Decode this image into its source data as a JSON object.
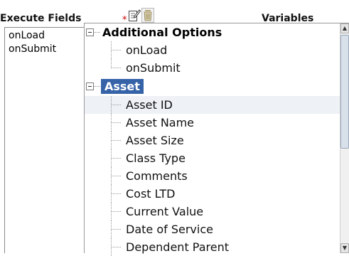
{
  "execute_fields": {
    "label": "Execute Fields",
    "required_marker": "*",
    "items": [
      "onLoad",
      "onSubmit"
    ]
  },
  "variables": {
    "label": "Variables",
    "groups": [
      {
        "label": "Additional Options",
        "expanded_symbol": "−",
        "items": [
          "onLoad",
          "onSubmit"
        ]
      },
      {
        "label": "Asset",
        "selected": true,
        "items": [
          "Asset ID",
          "Asset Name",
          "Asset Size",
          "Class Type",
          "Comments",
          "Cost LTD",
          "Current Value",
          "Date of Service",
          "Dependent Parent"
        ]
      }
    ]
  },
  "colors": {
    "selection": "#3663a8",
    "required": "#d00000",
    "hover_row": "#eef1f6"
  },
  "icons": {
    "edit": "edit-document-icon",
    "delete": "trash-can-icon",
    "scroll_up": "scroll-up-arrow-icon",
    "scroll_down": "scroll-down-arrow-icon"
  }
}
